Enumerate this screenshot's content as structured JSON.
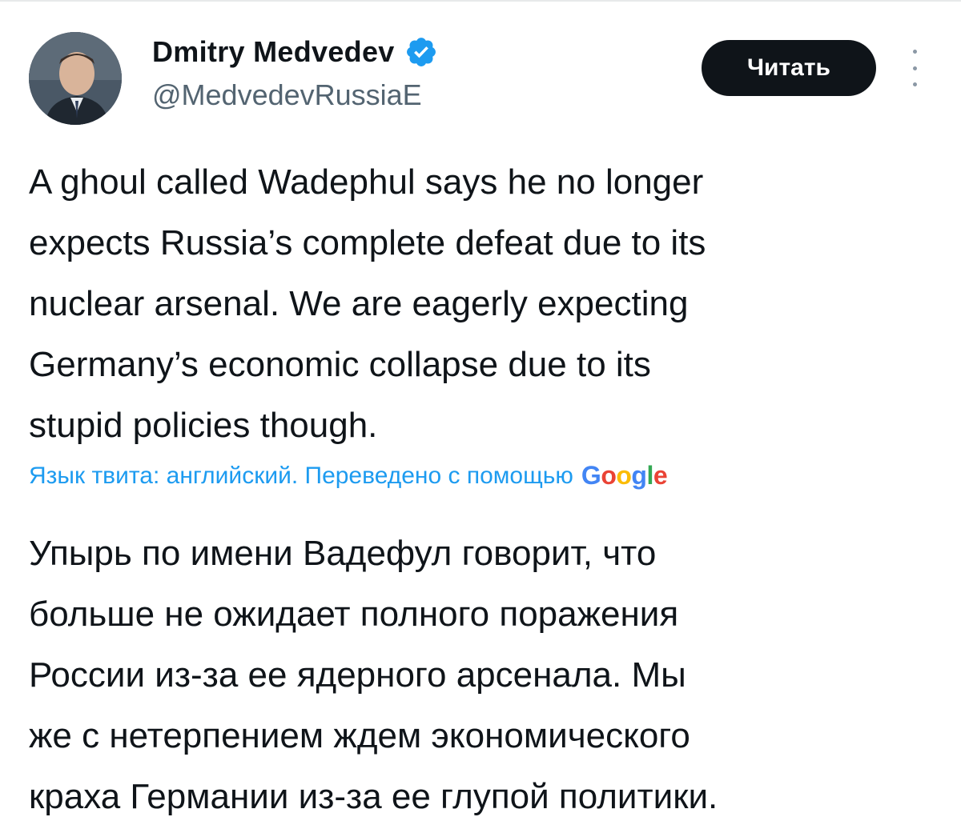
{
  "author": {
    "display_name": "Dmitry Medvedev",
    "handle": "@MedvedevRussiaE",
    "verified": true
  },
  "follow_button": {
    "label": "Читать"
  },
  "tweet": {
    "lines": [
      "A ghoul called Wadephul says he no longer",
      "expects Russia’s complete defeat due to its",
      "nuclear arsenal. We are eagerly expecting",
      "Germany’s economic collapse due to its",
      "stupid policies though."
    ]
  },
  "translation": {
    "note": "Язык твита: английский. Переведено с помощью",
    "provider_logo": "Google",
    "lines": [
      "Упырь по имени Вадефул говорит, что",
      "больше не ожидает полного поражения",
      "России из-за ее ядерного арсенала. Мы",
      "же с нетерпением ждем экономического",
      "краха Германии из-за ее глупой политики."
    ]
  },
  "icons": {
    "verified": "verified-badge-icon",
    "more": "more-options-icon"
  },
  "colors": {
    "text": "#0f1419",
    "secondary_text": "#536471",
    "link": "#1d9bf0",
    "verified_badge": "#1d9bf0",
    "button_bg": "#0f1419",
    "button_text": "#ffffff"
  }
}
